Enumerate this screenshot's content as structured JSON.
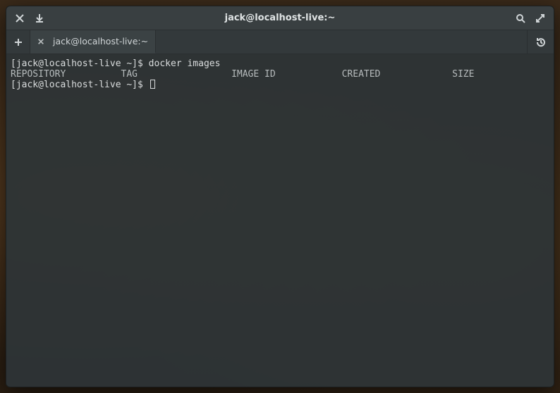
{
  "window": {
    "title": "jack@localhost-live:~"
  },
  "tabs": [
    {
      "label": "jack@localhost-live:~"
    }
  ],
  "terminal": {
    "prompt": "[jack@localhost-live ~]$",
    "lines": [
      {
        "prompt": "[jack@localhost-live ~]$",
        "command": "docker images"
      }
    ],
    "columns_line": "REPOSITORY          TAG                 IMAGE ID            CREATED             SIZE",
    "columns": [
      "REPOSITORY",
      "TAG",
      "IMAGE ID",
      "CREATED",
      "SIZE"
    ],
    "rows": [],
    "current_prompt": "[jack@localhost-live ~]$"
  },
  "icons": {
    "close": "close-icon",
    "download": "download-icon",
    "search": "search-icon",
    "fullscreen": "fullscreen-icon",
    "plus": "plus-icon",
    "history": "history-icon"
  }
}
